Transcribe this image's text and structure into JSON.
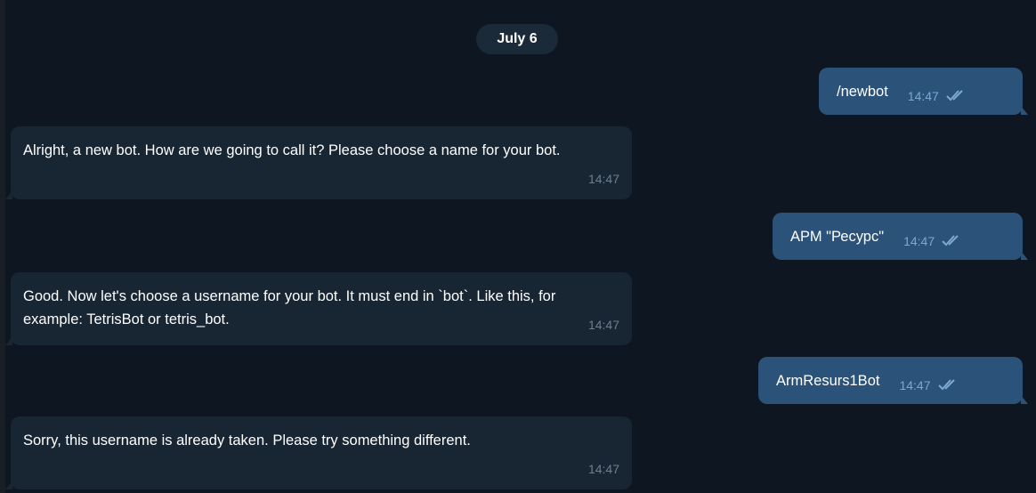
{
  "date_divider": "July 6",
  "messages": [
    {
      "direction": "out",
      "text": "/newbot",
      "time": "14:47",
      "status_icon": "double-check-icon"
    },
    {
      "direction": "in",
      "text": "Alright, a new bot. How are we going to call it? Please choose a name for your bot.",
      "time": "14:47"
    },
    {
      "direction": "out",
      "text": "АРМ \"Ресурс\"",
      "time": "14:47",
      "status_icon": "double-check-icon"
    },
    {
      "direction": "in",
      "text": "Good. Now let's choose a username for your bot. It must end in `bot`. Like this, for example: TetrisBot or tetris_bot.",
      "time": "14:47"
    },
    {
      "direction": "out",
      "text": "ArmResurs1Bot",
      "time": "14:47",
      "status_icon": "double-check-icon"
    },
    {
      "direction": "in",
      "text": "Sorry, this username is already taken. Please try something different.",
      "time": "14:47"
    }
  ],
  "colors": {
    "background": "#0e1621",
    "incoming_bubble": "#182533",
    "outgoing_bubble": "#2b5278",
    "read_check": "#7da8d3"
  }
}
